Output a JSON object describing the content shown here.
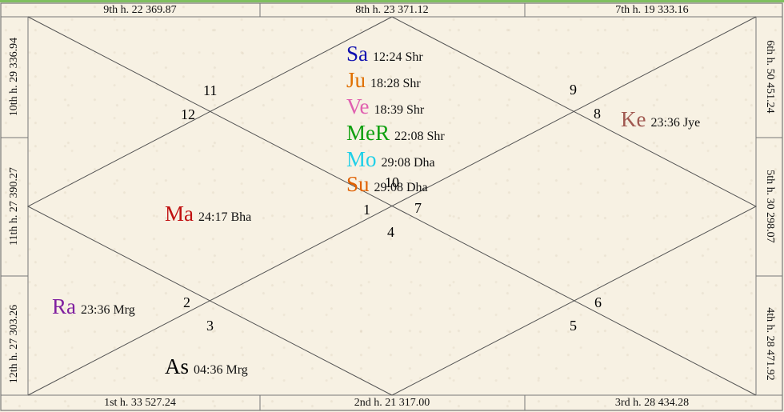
{
  "colors": {
    "frame": "#777777",
    "line": "#555555",
    "sa": "#1010b0",
    "ju": "#e07000",
    "ve": "#e060b0",
    "mer": "#10a010",
    "mo": "#20d0e8",
    "su": "#e06000",
    "ma": "#c01010",
    "ke": "#a05850",
    "ra": "#8020a0",
    "as": "#000000"
  },
  "house_headers": {
    "h9": "9th h.  22  369.87",
    "h8": "8th h.  23  371.12",
    "h7": "7th h.  19  333.16",
    "h10": "10th h.  29  336.94",
    "h11": "11th h.  27  390.27",
    "h12": "12th h.  27  303.26",
    "h6": "6th h.  50  451.24",
    "h5": "5th h.  30  298.07",
    "h4": "4th h.  28  471.92",
    "h1": "1st h.  33  527.24",
    "h2": "2nd h.  21  317.00",
    "h3": "3rd h.  28  434.28"
  },
  "house_numbers": {
    "n11": "11",
    "n12": "12",
    "n9": "9",
    "n8": "8",
    "n10": "10",
    "n1": "1",
    "n7": "7",
    "n4": "4",
    "n2": "2",
    "n3": "3",
    "n6": "6",
    "n5": "5"
  },
  "planets": {
    "sa": {
      "name": "Sa",
      "deg": "12:24 Shr"
    },
    "ju": {
      "name": "Ju",
      "deg": "18:28 Shr"
    },
    "ve": {
      "name": "Ve",
      "deg": "18:39 Shr"
    },
    "mer": {
      "name": "MeR",
      "deg": "22:08 Shr"
    },
    "mo": {
      "name": "Mo",
      "deg": "29:08 Dha"
    },
    "su": {
      "name": "Su",
      "deg": "29:08 Dha"
    },
    "ma": {
      "name": "Ma",
      "deg": "24:17 Bha"
    },
    "ke": {
      "name": "Ke",
      "deg": "23:36 Jye"
    },
    "ra": {
      "name": "Ra",
      "deg": "23:36 Mrg"
    },
    "as": {
      "name": "As",
      "deg": "04:36 Mrg"
    }
  }
}
